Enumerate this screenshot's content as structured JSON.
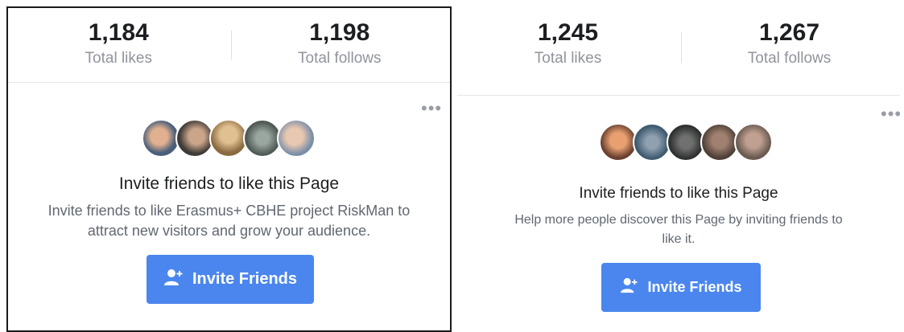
{
  "left_card": {
    "stats": [
      {
        "value": "1,184",
        "label": "Total likes"
      },
      {
        "value": "1,198",
        "label": "Total follows"
      }
    ],
    "more_icon": "more-horizontal-icon",
    "invite_title": "Invite friends to like this Page",
    "invite_description_line1": "Invite friends to like Erasmus+ CBHE project RiskMan to",
    "invite_description_line2": "attract new visitors and grow your audience.",
    "button_label": "Invite Friends",
    "button_icon": "add-person-icon"
  },
  "right_card": {
    "stats": [
      {
        "value": "1,245",
        "label": "Total likes"
      },
      {
        "value": "1,267",
        "label": "Total follows"
      }
    ],
    "more_icon": "more-horizontal-icon",
    "invite_title": "Invite friends to like this Page",
    "invite_description_line1": "Help more people discover this Page by inviting friends to",
    "invite_description_line2": "like it.",
    "button_label": "Invite Friends",
    "button_icon": "add-person-icon"
  },
  "colors": {
    "accent": "#4a86ee",
    "text_primary": "#1c1e21",
    "text_secondary": "#90949c"
  }
}
